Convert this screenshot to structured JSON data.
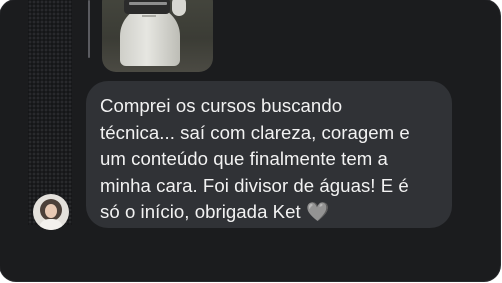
{
  "message": {
    "lines": [
      "Comprei os cursos buscando",
      "técnica... saí com clareza, coragem e",
      "um conteúdo que finalmente tem a",
      "minha cara. Foi divisor de águas! E é",
      "só o início, obrigada Ket 🩶"
    ]
  },
  "story_preview": {
    "icon": "story-photo-thumbnail"
  },
  "sender": {
    "icon": "avatar-photo"
  },
  "colors": {
    "background": "#1b1c1e",
    "bubble": "#303236",
    "text": "#f2f2f2"
  }
}
